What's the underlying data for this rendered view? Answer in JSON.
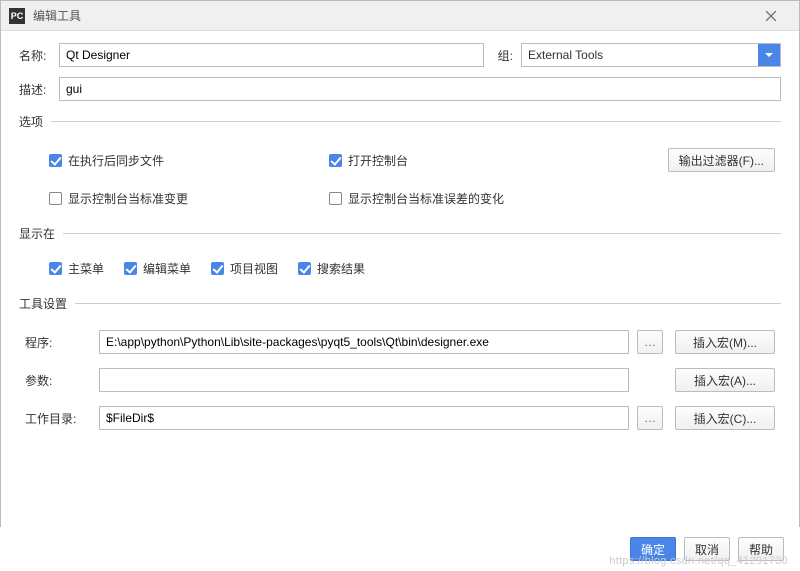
{
  "window": {
    "app_icon_text": "PC",
    "title": "编辑工具"
  },
  "form": {
    "name_label": "名称:",
    "name_value": "Qt Designer",
    "group_label": "组:",
    "group_value": "External Tools",
    "desc_label": "描述:",
    "desc_value": "gui"
  },
  "options": {
    "legend": "选项",
    "sync_after_exec": "在执行后同步文件",
    "open_console": "打开控制台",
    "show_std_change": "显示控制台当标准变更",
    "show_stderr_change": "显示控制台当标准误差的变化",
    "output_filter_btn": "输出过滤器(F)..."
  },
  "show_in": {
    "legend": "显示在",
    "main_menu": "主菜单",
    "edit_menu": "编辑菜单",
    "project_view": "项目视图",
    "search_results": "搜索结果"
  },
  "tool_settings": {
    "legend": "工具设置",
    "program_label": "程序:",
    "program_value": "E:\\app\\python\\Python\\Lib\\site-packages\\pyqt5_tools\\Qt\\bin\\designer.exe",
    "program_macro_btn": "插入宏(M)...",
    "params_label": "参数:",
    "params_value": "",
    "params_macro_btn": "插入宏(A)...",
    "workdir_label": "工作目录:",
    "workdir_value": "$FileDir$",
    "workdir_macro_btn": "插入宏(C)...",
    "browse_icon": "…"
  },
  "footer": {
    "ok": "确定",
    "cancel": "取消",
    "help": "帮助"
  },
  "watermark": "https://blog.csdn.net/qq_41291730"
}
